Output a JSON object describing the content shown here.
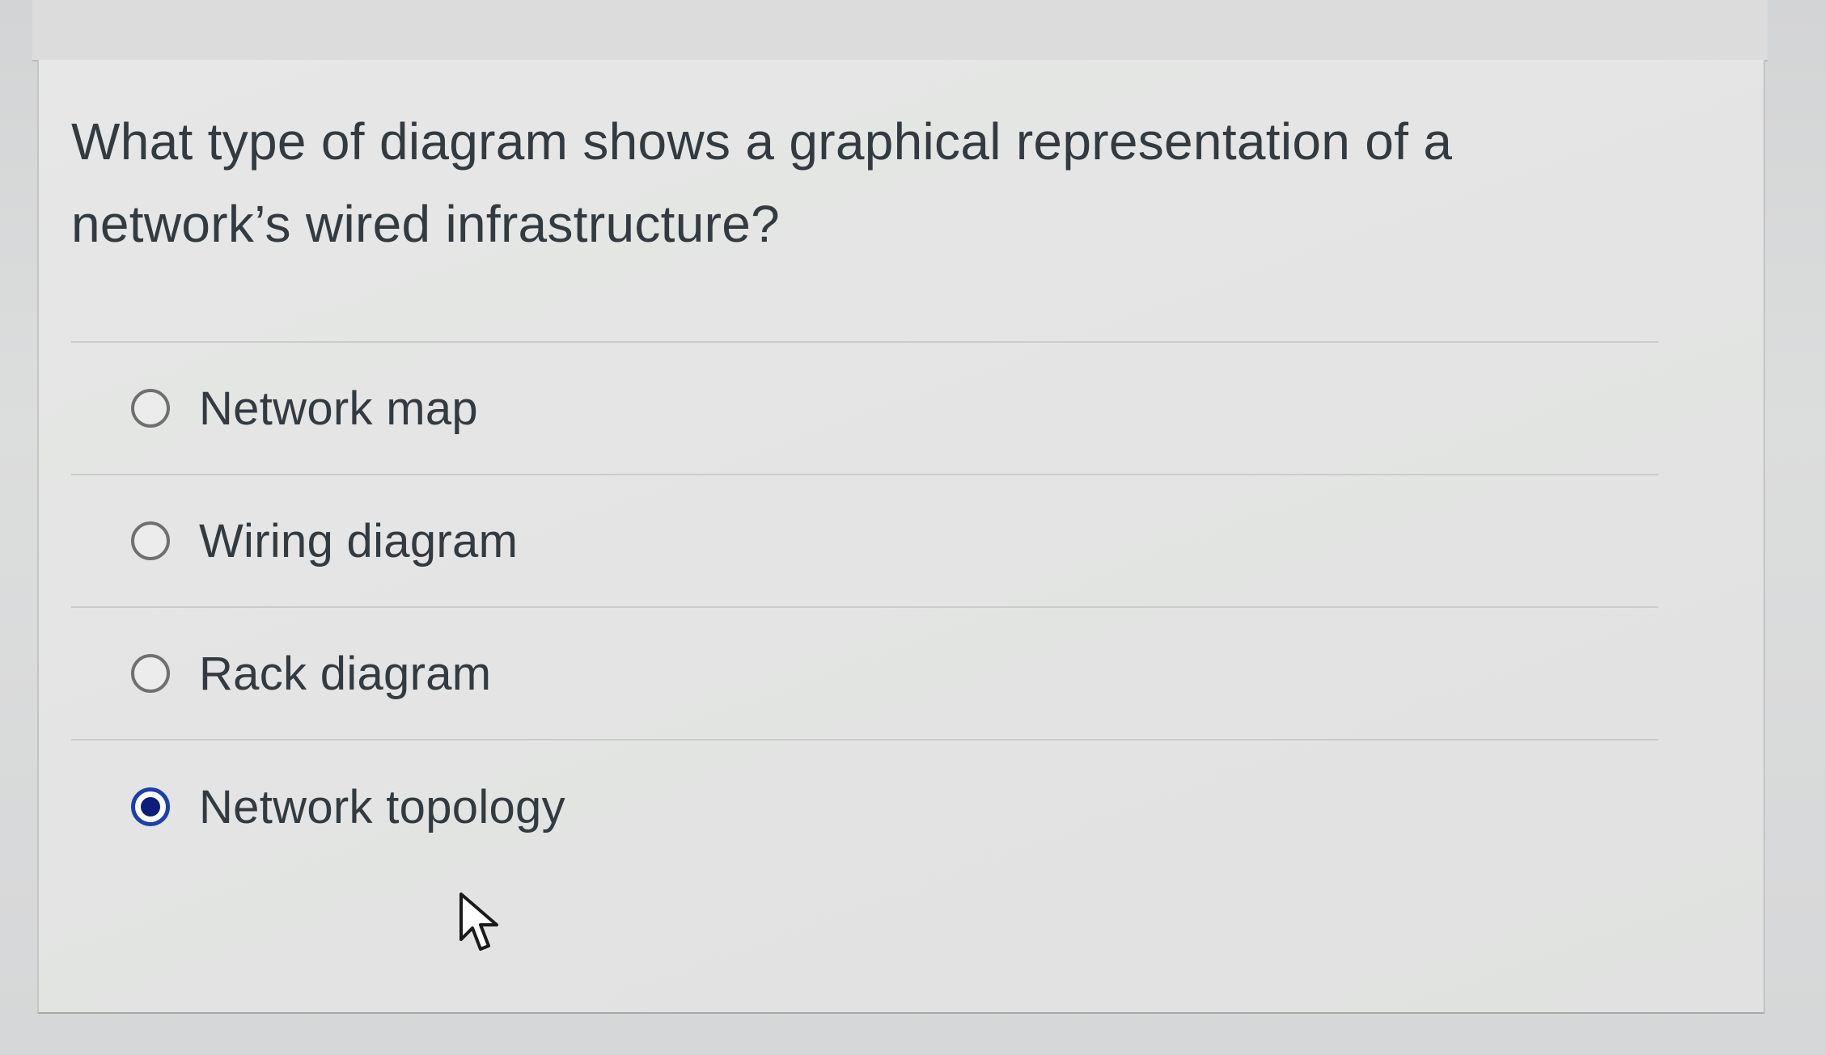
{
  "question": {
    "text": "What type of diagram shows a graphical representation of a network’s wired infrastructure?"
  },
  "options": [
    {
      "label": "Network map",
      "selected": false
    },
    {
      "label": "Wiring diagram",
      "selected": false
    },
    {
      "label": "Rack diagram",
      "selected": false
    },
    {
      "label": "Network topology",
      "selected": true
    }
  ],
  "icons": {
    "radio_unselected": "radio-unselected-icon",
    "radio_selected": "radio-selected-icon",
    "cursor": "mouse-pointer-icon"
  },
  "colors": {
    "text": "#333a40",
    "radio_selected": "#1b3fae",
    "radio_border": "#6f6f6f",
    "card_background": "#e4e5e4"
  }
}
